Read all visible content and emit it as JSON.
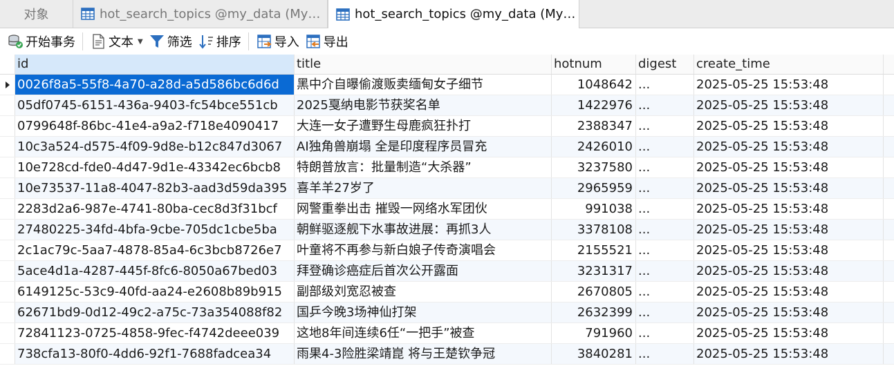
{
  "tabs": [
    {
      "label": "对象"
    },
    {
      "label": "hot_search_topics @my_data (MyS..."
    },
    {
      "label": "hot_search_topics @my_data (MyS..."
    }
  ],
  "toolbar": {
    "begin_transaction": "开始事务",
    "text": "文本",
    "filter": "筛选",
    "sort": "排序",
    "import": "导入",
    "export": "导出"
  },
  "columns": [
    "id",
    "title",
    "hotnum",
    "digest",
    "create_time"
  ],
  "rows": [
    {
      "id": "0026f8a5-55f8-4a70-a28d-a5d586bc6d6d",
      "title": "黑中介自曝偷渡贩卖缅甸女子细节",
      "hotnum": "1048642",
      "digest": "...",
      "create_time": "2025-05-25 15:53:48"
    },
    {
      "id": "05df0745-6151-436a-9403-fc54bce551cb",
      "title": "2025戛纳电影节获奖名单",
      "hotnum": "1422976",
      "digest": "...",
      "create_time": "2025-05-25 15:53:48"
    },
    {
      "id": "0799648f-86bc-41e4-a9a2-f718e4090417",
      "title": "大连一女子遭野生母鹿疯狂扑打",
      "hotnum": "2388347",
      "digest": "...",
      "create_time": "2025-05-25 15:53:48"
    },
    {
      "id": "10c3a524-d575-4f09-9d8e-b12c847d3067",
      "title": "AI独角兽崩塌 全是印度程序员冒充",
      "hotnum": "2426010",
      "digest": "...",
      "create_time": "2025-05-25 15:53:48"
    },
    {
      "id": "10e728cd-fde0-4d47-9d1e-43342ec6bcb8",
      "title": "特朗普放言：批量制造“大杀器”",
      "hotnum": "3237580",
      "digest": "...",
      "create_time": "2025-05-25 15:53:48"
    },
    {
      "id": "10e73537-11a8-4047-82b3-aad3d59da395",
      "title": "喜羊羊27岁了",
      "hotnum": "2965959",
      "digest": "...",
      "create_time": "2025-05-25 15:53:48"
    },
    {
      "id": "2283d2a6-987e-4741-80ba-cec8d3f31bcf",
      "title": "网警重拳出击 摧毁一网络水军团伙",
      "hotnum": "991038",
      "digest": "...",
      "create_time": "2025-05-25 15:53:48"
    },
    {
      "id": "27480225-34fd-4bfa-9cbe-705dc1cbe5ba",
      "title": "朝鲜驱逐舰下水事故进展：再抓3人",
      "hotnum": "3378108",
      "digest": "...",
      "create_time": "2025-05-25 15:53:48"
    },
    {
      "id": "2c1ac79c-5aa7-4878-85a4-6c3bcb8726e7",
      "title": "叶童将不再参与新白娘子传奇演唱会",
      "hotnum": "2155521",
      "digest": "...",
      "create_time": "2025-05-25 15:53:48"
    },
    {
      "id": "5ace4d1a-4287-445f-8fc6-8050a67bed03",
      "title": "拜登确诊癌症后首次公开露面",
      "hotnum": "3231317",
      "digest": "...",
      "create_time": "2025-05-25 15:53:48"
    },
    {
      "id": "6149125c-53c9-40fd-aa24-e2608b89b915",
      "title": "副部级刘宽忍被查",
      "hotnum": "2670805",
      "digest": "...",
      "create_time": "2025-05-25 15:53:48"
    },
    {
      "id": "62671bd9-0d12-49c2-a75c-73a354088f82",
      "title": "国乒今晚3场神仙打架",
      "hotnum": "2632399",
      "digest": "...",
      "create_time": "2025-05-25 15:53:48"
    },
    {
      "id": "72841123-0725-4858-9fec-f4742deee039",
      "title": "这地8年间连续6任“一把手”被查",
      "hotnum": "791960",
      "digest": "...",
      "create_time": "2025-05-25 15:53:48"
    },
    {
      "id": "738cfa13-80f0-4dd6-92f1-7688fadcea34",
      "title": "雨果4-3险胜梁靖崑 将与王楚钦争冠",
      "hotnum": "3840281",
      "digest": "...",
      "create_time": "2025-05-25 15:53:48"
    }
  ],
  "selected_row": 0,
  "icons": {
    "table_tab": "table-icon",
    "begin_transaction": "database-icon",
    "text": "text-document-icon",
    "filter": "funnel-icon",
    "sort": "sort-arrows-icon",
    "import": "import-icon",
    "export": "export-icon"
  },
  "colors": {
    "selection": "#0a6ad4",
    "header_highlight": "#d6e8fa",
    "alt_row": "#f4f8fd",
    "icon_blue": "#2c6fbf",
    "icon_orange": "#e07b20"
  }
}
